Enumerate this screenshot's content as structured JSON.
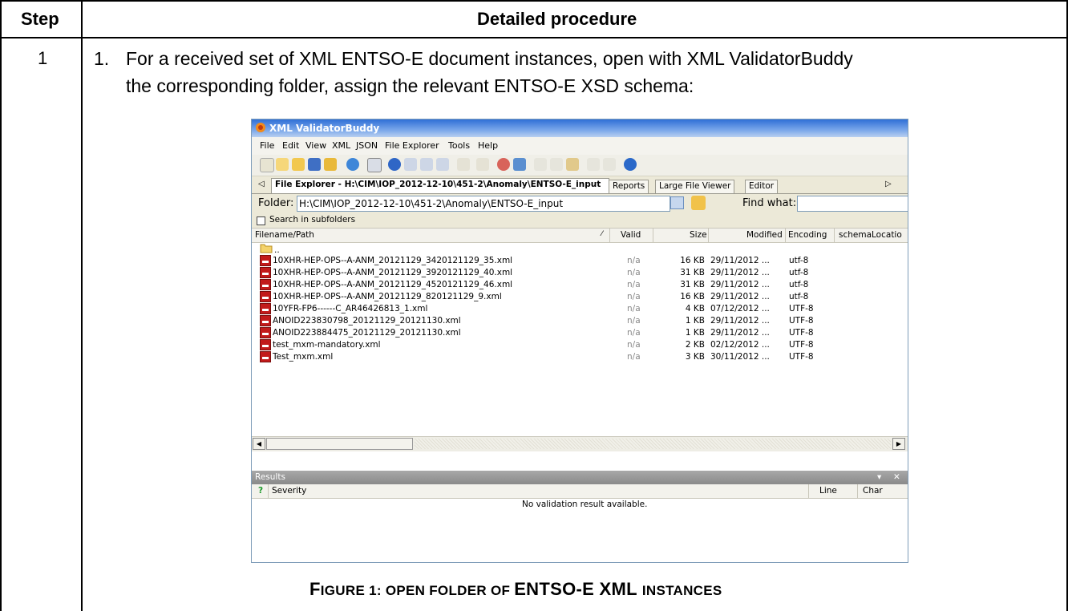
{
  "table": {
    "header_step": "Step",
    "header_procedure": "Detailed procedure",
    "step_number": "1",
    "item_number": "1.",
    "line1": "For a received set of XML ENTSO-E document instances, open with XML ValidatorBuddy",
    "line2": "the corresponding folder, assign the relevant ENTSO-E XSD schema:",
    "caption_part1": "F",
    "caption_part2": "IGURE 1: O",
    "caption_part3": "PEN FOLDER OF ",
    "caption_part4": "ENTSO-E XML ",
    "caption_part5": "INSTANCES"
  },
  "app": {
    "title": "XML ValidatorBuddy",
    "menu": [
      "File",
      "Edit",
      "View",
      "XML",
      "JSON",
      "File Explorer",
      "Tools",
      "Help"
    ],
    "tabs": {
      "file_explorer": "File Explorer - H:\\CIM\\IOP_2012-12-10\\451-2\\Anomaly\\ENTSO-E_input",
      "reports": "Reports",
      "large_file_viewer": "Large File Viewer",
      "editor": "Editor"
    },
    "folder_label": "Folder:",
    "folder_value": "H:\\CIM\\IOP_2012-12-10\\451-2\\Anomaly\\ENTSO-E_input",
    "find_label": "Find what:",
    "find_value": "",
    "search_subfolders": "Search in subfolders",
    "columns": {
      "filename": "Filename/Path",
      "valid": "Valid",
      "size": "Size",
      "modified": "Modified",
      "encoding": "Encoding",
      "schema": "schemaLocatio"
    },
    "parent_dir": "..",
    "files": [
      {
        "name": "10XHR-HEP-OPS--A-ANM_20121129_3420121129_35.xml",
        "valid": "n/a",
        "size": "16 KB",
        "modified": "29/11/2012 ...",
        "encoding": "utf-8"
      },
      {
        "name": "10XHR-HEP-OPS--A-ANM_20121129_3920121129_40.xml",
        "valid": "n/a",
        "size": "31 KB",
        "modified": "29/11/2012 ...",
        "encoding": "utf-8"
      },
      {
        "name": "10XHR-HEP-OPS--A-ANM_20121129_4520121129_46.xml",
        "valid": "n/a",
        "size": "31 KB",
        "modified": "29/11/2012 ...",
        "encoding": "utf-8"
      },
      {
        "name": "10XHR-HEP-OPS--A-ANM_20121129_820121129_9.xml",
        "valid": "n/a",
        "size": "16 KB",
        "modified": "29/11/2012 ...",
        "encoding": "utf-8"
      },
      {
        "name": "10YFR-FP6------C_AR46426813_1.xml",
        "valid": "n/a",
        "size": "4 KB",
        "modified": "07/12/2012 ...",
        "encoding": "UTF-8"
      },
      {
        "name": "ANOID223830798_20121129_20121130.xml",
        "valid": "n/a",
        "size": "1 KB",
        "modified": "29/11/2012 ...",
        "encoding": "UTF-8"
      },
      {
        "name": "ANOID223884475_20121129_20121130.xml",
        "valid": "n/a",
        "size": "1 KB",
        "modified": "29/11/2012 ...",
        "encoding": "UTF-8"
      },
      {
        "name": "test_mxm-mandatory.xml",
        "valid": "n/a",
        "size": "2 KB",
        "modified": "02/12/2012 ...",
        "encoding": "UTF-8"
      },
      {
        "name": "Test_mxm.xml",
        "valid": "n/a",
        "size": "3 KB",
        "modified": "30/11/2012 ...",
        "encoding": "UTF-8"
      }
    ],
    "results": {
      "title": "Results",
      "col_q": "?",
      "col_severity": "Severity",
      "col_line": "Line",
      "col_char": "Char",
      "empty_message": "No validation result available."
    }
  }
}
